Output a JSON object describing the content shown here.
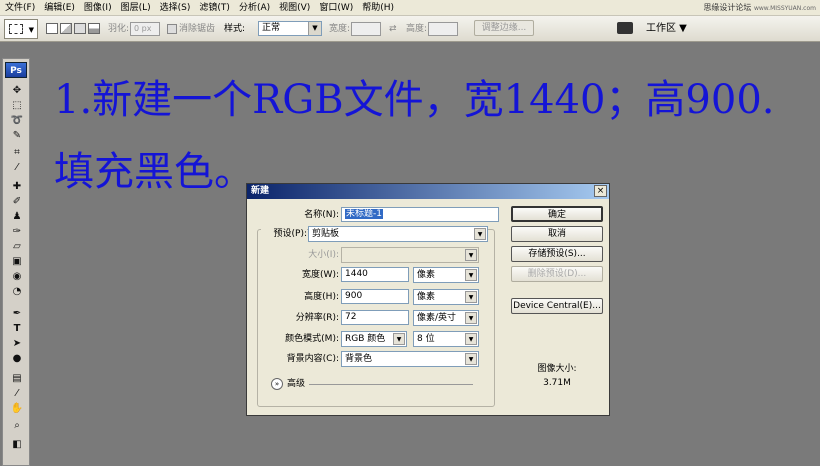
{
  "menubar": {
    "items": [
      "文件(F)",
      "编辑(E)",
      "图像(I)",
      "图层(L)",
      "选择(S)",
      "滤镜(T)",
      "分析(A)",
      "视图(V)",
      "窗口(W)",
      "帮助(H)"
    ],
    "watermark": "思缘设计论坛",
    "watermark_url": "www.MISSYUAN.com"
  },
  "optionsbar": {
    "feather_label": "羽化:",
    "feather_value": "0 px",
    "antialias_label": "消除锯齿",
    "style_label": "样式:",
    "style_value": "正常",
    "width_label": "宽度:",
    "swap_icon": "⇄",
    "height_label": "高度:",
    "refine_edge": "调整边缘...",
    "workspace": "工作区 ▼"
  },
  "toolbox": {
    "logo": "Ps",
    "tools": [
      "move-icon",
      "marquee-icon",
      "lasso-icon",
      "quick-select-icon",
      "crop-icon",
      "eyedropper-icon",
      "healing-icon",
      "brush-icon",
      "stamp-icon",
      "history-brush-icon",
      "eraser-icon",
      "gradient-icon",
      "blur-icon",
      "dodge-icon",
      "pen-icon",
      "type-icon",
      "path-select-icon",
      "shape-icon",
      "notes-icon",
      "eyedropper2-icon",
      "hand-icon",
      "zoom-icon",
      "color-swatches-icon"
    ]
  },
  "canvas_text": {
    "line1": "1.新建一个RGB文件，宽1440；高900.",
    "line2": "填充黑色。"
  },
  "dialog": {
    "title": "新建",
    "close": "×",
    "name_label": "名称(N):",
    "name_value": "未标题-1",
    "preset_label": "预设(P):",
    "preset_value": "剪贴板",
    "size_label": "大小(I):",
    "width_label": "宽度(W):",
    "width_value": "1440",
    "width_unit": "像素",
    "height_label": "高度(H):",
    "height_value": "900",
    "height_unit": "像素",
    "resolution_label": "分辨率(R):",
    "resolution_value": "72",
    "resolution_unit": "像素/英寸",
    "color_mode_label": "颜色模式(M):",
    "color_mode_value": "RGB 颜色",
    "bit_depth_value": "8 位",
    "background_label": "背景内容(C):",
    "background_value": "背景色",
    "advanced_label": "高级",
    "ok_button": "确定",
    "cancel_button": "取消",
    "save_preset_button": "存储预设(S)...",
    "delete_preset_button": "删除预设(D)...",
    "device_central_button": "Device Central(E)...",
    "image_size_label": "图像大小:",
    "image_size_value": "3.71M"
  }
}
